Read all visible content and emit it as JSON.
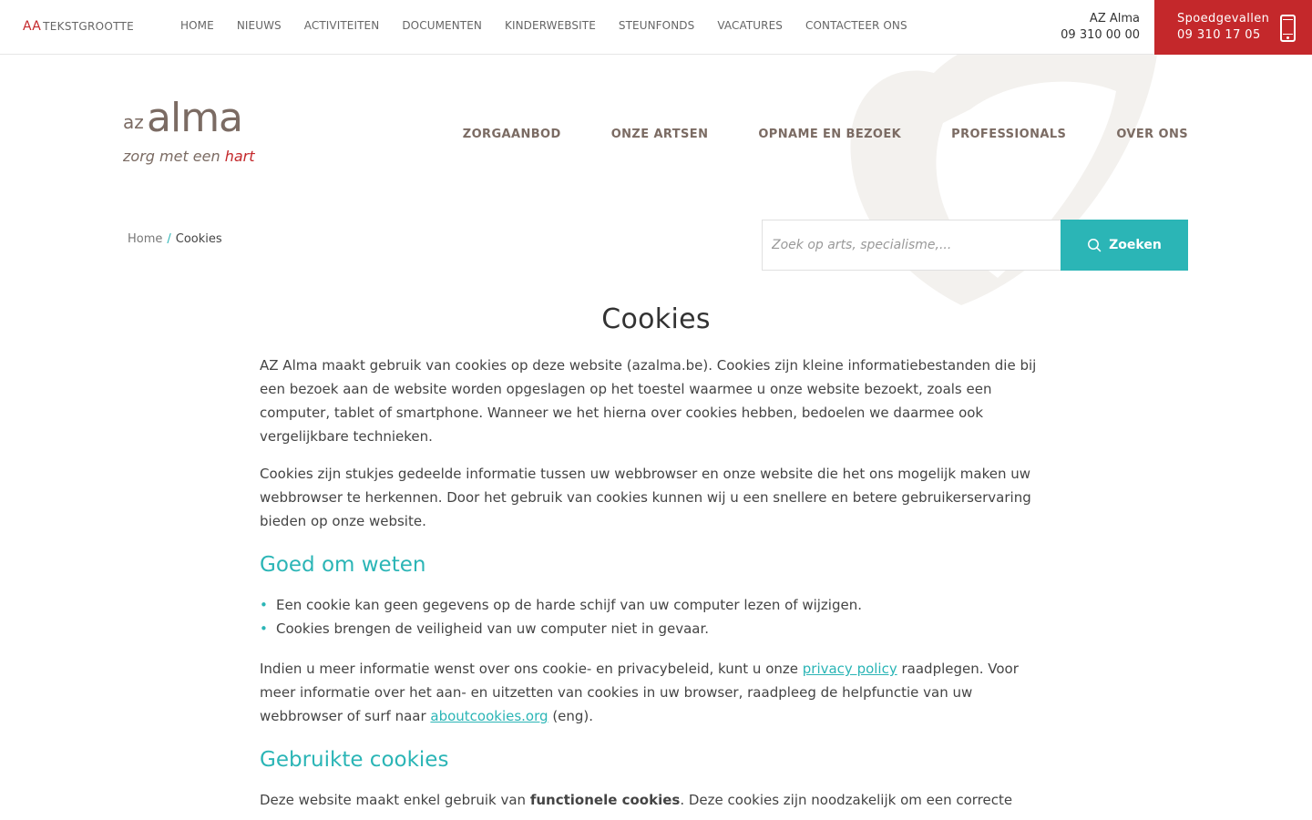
{
  "topbar": {
    "textsize_icon": "AA",
    "textsize_label": "TEKSTGROOTTE",
    "nav": [
      "HOME",
      "NIEUWS",
      "ACTIVITEITEN",
      "DOCUMENTEN",
      "KINDERWEBSITE",
      "STEUNFONDS",
      "VACATURES",
      "CONTACTEER ONS"
    ],
    "az_name": "AZ Alma",
    "az_phone": "09 310 00 00",
    "emergency_label": "Spoedgevallen",
    "emergency_phone": "09 310 17 05",
    "emergency_icon": "mobile-phone-icon"
  },
  "logo": {
    "prefix": "az",
    "name": "alma",
    "tagline_start": "zorg met een ",
    "tagline_end": "hart"
  },
  "mainnav": [
    "ZORGAANBOD",
    "ONZE ARTSEN",
    "OPNAME EN BEZOEK",
    "PROFESSIONALS",
    "OVER ONS"
  ],
  "breadcrumb": {
    "home": "Home",
    "separator": "/",
    "current": "Cookies"
  },
  "search": {
    "placeholder": "Zoek op arts, specialisme,...",
    "button": "Zoeken",
    "icon": "search-icon"
  },
  "content": {
    "title": "Cookies",
    "p1": "AZ Alma maakt gebruik van cookies op deze website (azalma.be). Cookies zijn kleine informatiebestanden die bij een bezoek aan de website worden opgeslagen op het toestel waarmee u onze website bezoekt, zoals een computer, tablet of smartphone. Wanneer we het hierna over cookies hebben, bedoelen we daarmee ook vergelijkbare technieken.",
    "p2": "Cookies zijn stukjes gedeelde informatie tussen uw webbrowser en onze website die het ons mogelijk maken uw webbrowser te herkennen. Door het gebruik van cookies kunnen wij u een snellere en betere gebruikerservaring bieden op onze website.",
    "h_goed": "Goed om weten",
    "bullets": [
      "Een cookie kan geen gegevens op de harde schijf van uw computer lezen of wijzigen.",
      "Cookies brengen de veiligheid van uw computer niet in gevaar."
    ],
    "p3_a": "Indien u meer informatie wenst over ons cookie- en privacybeleid, kunt u onze ",
    "p3_link1": "privacy policy",
    "p3_b": " raadplegen. Voor meer informatie over het aan- en uitzetten van cookies in uw browser, raadpleeg de helpfunctie van uw webbrowser of surf naar ",
    "p3_link2": "aboutcookies.org",
    "p3_c": " (eng).",
    "h_gebruikte": "Gebruikte cookies",
    "p4_a": "Deze website maakt enkel gebruik van ",
    "p4_bold": "functionele cookies",
    "p4_b": ". Deze cookies zijn noodzakelijk om een correcte"
  },
  "colors": {
    "brand_red": "#c4282b",
    "accent_teal": "#2bb5b6",
    "logo_brown": "#7b6b63"
  }
}
